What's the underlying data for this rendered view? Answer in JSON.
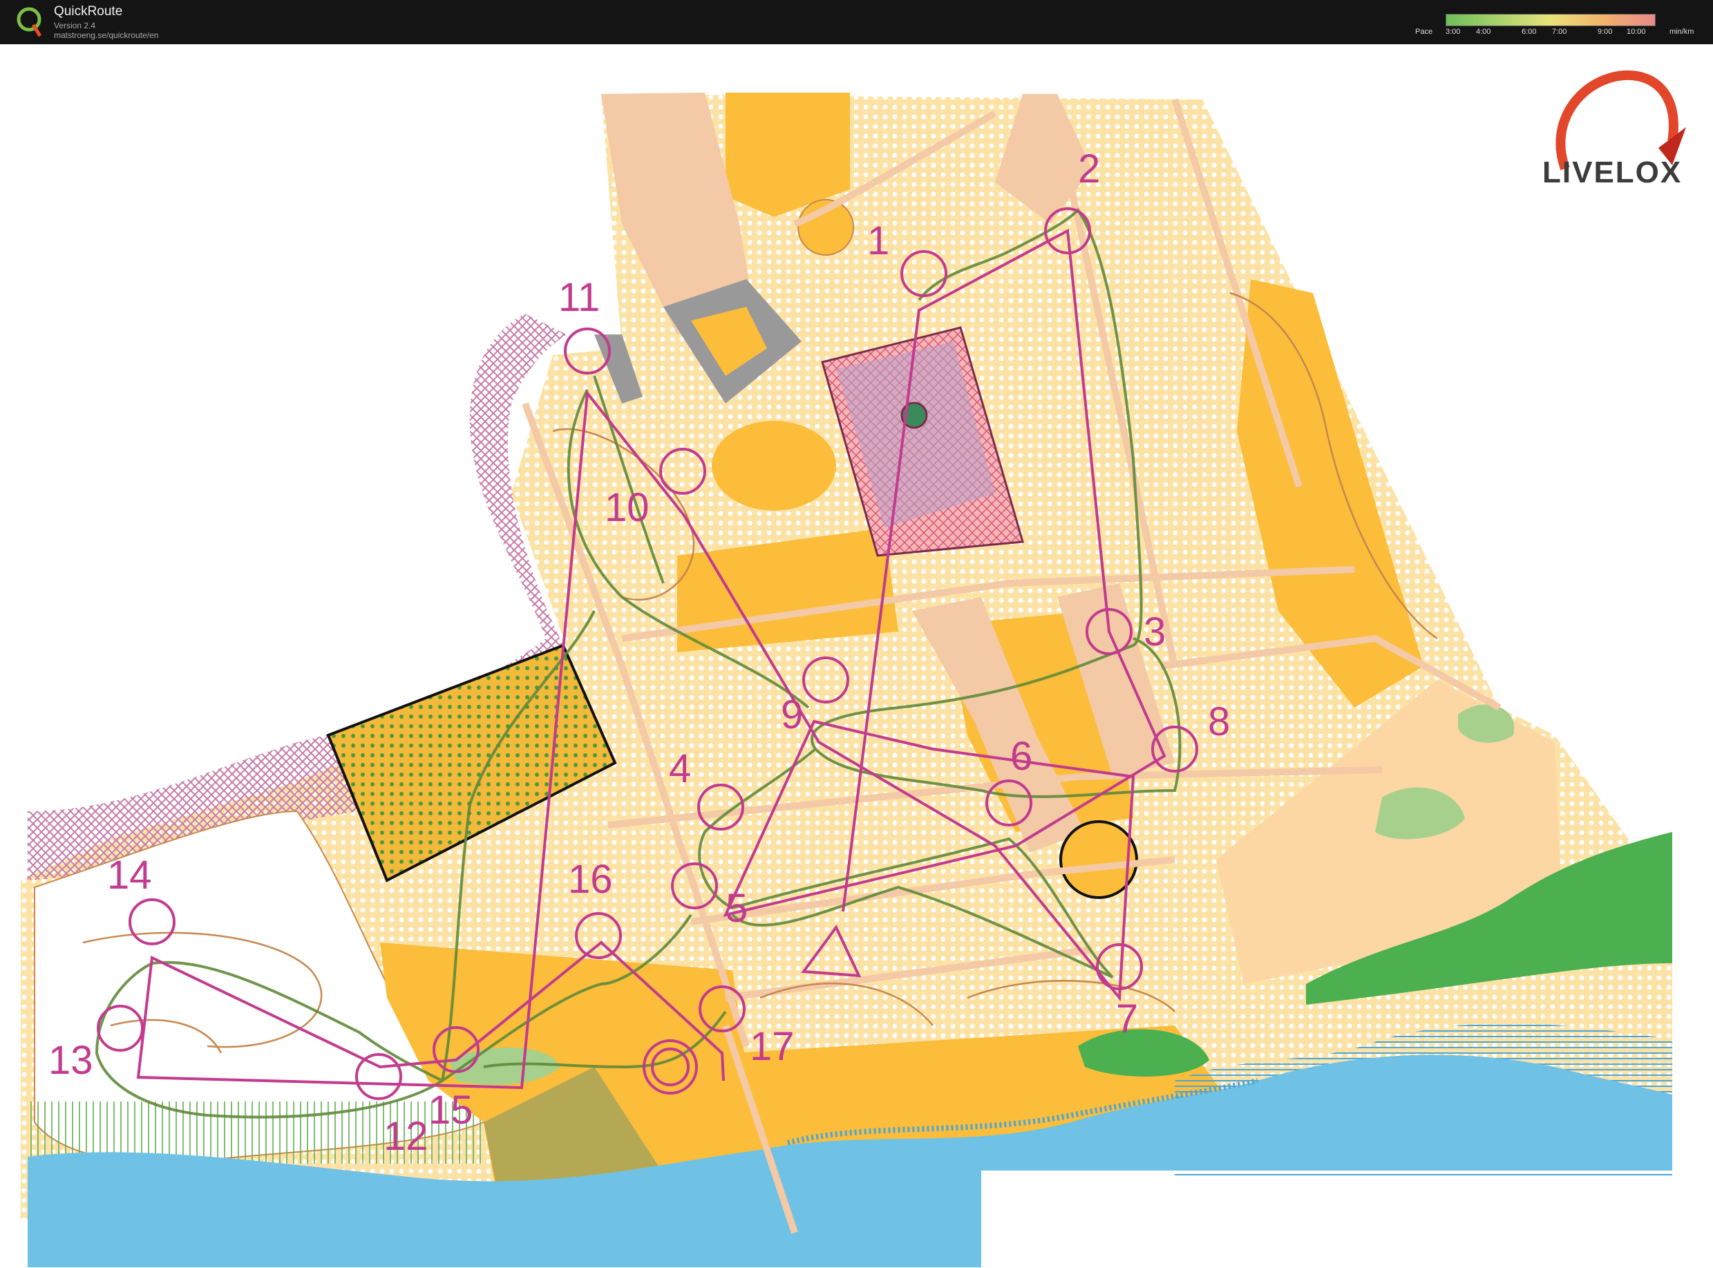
{
  "app": {
    "title": "QuickRoute",
    "version": "Version 2.4",
    "url": "matstroeng.se/quickroute/en"
  },
  "pace_legend": {
    "label": "Pace",
    "ticks": [
      "3:00",
      "4:00",
      "6:00",
      "7:00",
      "9:00",
      "10:00"
    ],
    "unit": "min/km"
  },
  "watermark": {
    "brand": "LIVELOX"
  },
  "map": {
    "colors": {
      "open_land": "#fbbd3a",
      "rough_open": "#fde2a6",
      "paved": "#f4c9a5",
      "water": "#6fc2e5",
      "vegetation": "#4caf50",
      "course": "#c23b8e",
      "route": "#5f8a3a",
      "building": "#999999",
      "out_of_bounds": "#c77aa8"
    },
    "controls": [
      {
        "number": "1"
      },
      {
        "number": "2"
      },
      {
        "number": "3"
      },
      {
        "number": "4"
      },
      {
        "number": "5"
      },
      {
        "number": "6"
      },
      {
        "number": "7"
      },
      {
        "number": "8"
      },
      {
        "number": "9"
      },
      {
        "number": "10"
      },
      {
        "number": "11"
      },
      {
        "number": "12"
      },
      {
        "number": "13"
      },
      {
        "number": "14"
      },
      {
        "number": "15"
      },
      {
        "number": "16"
      },
      {
        "number": "17"
      }
    ]
  }
}
